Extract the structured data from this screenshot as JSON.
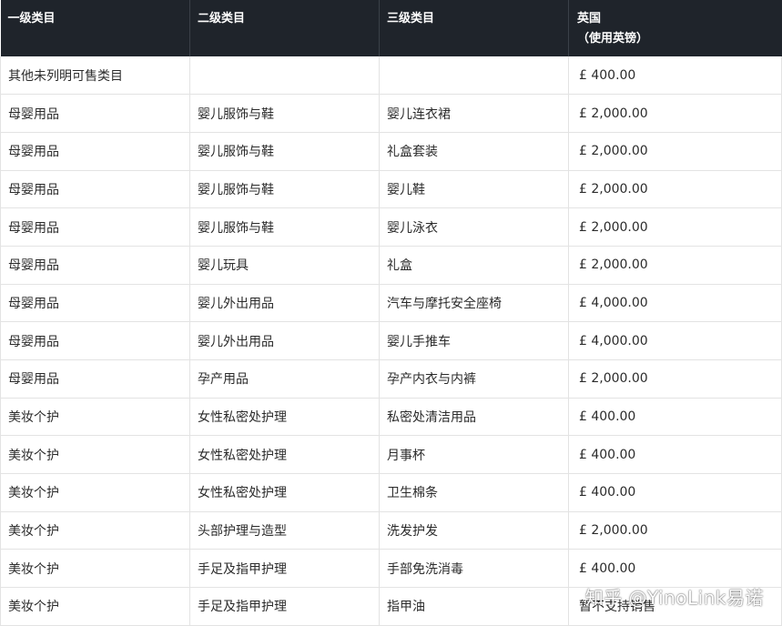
{
  "table": {
    "headers": {
      "level1": "一级类目",
      "level2": "二级类目",
      "level3": "三级类目",
      "uk_line1": "英国",
      "uk_line2": "（使用英镑）"
    },
    "rows": [
      [
        "其他未列明可售类目",
        "",
        "",
        "£ 400.00"
      ],
      [
        "母婴用品",
        "婴儿服饰与鞋",
        "婴儿连衣裙",
        "£ 2,000.00"
      ],
      [
        "母婴用品",
        "婴儿服饰与鞋",
        "礼盒套装",
        "£ 2,000.00"
      ],
      [
        "母婴用品",
        "婴儿服饰与鞋",
        "婴儿鞋",
        "£ 2,000.00"
      ],
      [
        "母婴用品",
        "婴儿服饰与鞋",
        "婴儿泳衣",
        "£ 2,000.00"
      ],
      [
        "母婴用品",
        "婴儿玩具",
        "礼盒",
        "£ 2,000.00"
      ],
      [
        "母婴用品",
        "婴儿外出用品",
        "汽车与摩托安全座椅",
        "£ 4,000.00"
      ],
      [
        "母婴用品",
        "婴儿外出用品",
        "婴儿手推车",
        "£ 4,000.00"
      ],
      [
        "母婴用品",
        "孕产用品",
        "孕产内衣与内裤",
        "£ 2,000.00"
      ],
      [
        "美妆个护",
        "女性私密处护理",
        "私密处清洁用品",
        "£ 400.00"
      ],
      [
        "美妆个护",
        "女性私密处护理",
        "月事杯",
        "£ 400.00"
      ],
      [
        "美妆个护",
        "女性私密处护理",
        "卫生棉条",
        "£ 400.00"
      ],
      [
        "美妆个护",
        "头部护理与造型",
        "洗发护发",
        "£ 2,000.00"
      ],
      [
        "美妆个护",
        "手足及指甲护理",
        "手部免洗消毒",
        "£ 400.00"
      ],
      [
        "美妆个护",
        "手足及指甲护理",
        "指甲油",
        "暂不支持销售"
      ]
    ]
  },
  "watermark": "知乎 @YinoLink易诺"
}
